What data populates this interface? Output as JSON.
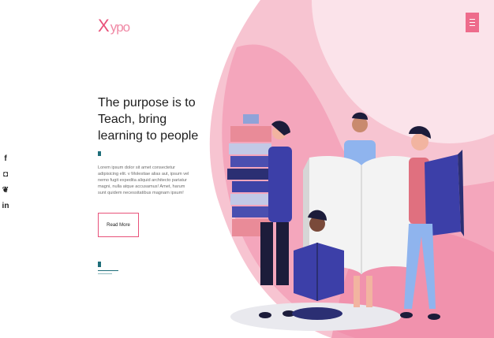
{
  "brand": {
    "logo_x": "X",
    "logo_rest": "ypo",
    "accent": "#e8527a"
  },
  "social": [
    {
      "name": "facebook-icon",
      "glyph": "f"
    },
    {
      "name": "instagram-icon",
      "glyph": "◘"
    },
    {
      "name": "twitter-icon",
      "glyph": "❦"
    },
    {
      "name": "linkedin-icon",
      "glyph": "in"
    }
  ],
  "hero": {
    "title": "The purpose is to Teach, bring learning to people",
    "text": "Lorem ipsum dolor sit amet consectetur adipisicing elit. v Molestiae alias aut, ipsum vel nemo fugit expedita aliquid architecto pariatur magni, nulla atque accusamus! Amet, harum sunt quidem necessitatibus magnam ipsum!",
    "button": "Read More"
  },
  "menu": {
    "icon": "hamburger-icon"
  }
}
